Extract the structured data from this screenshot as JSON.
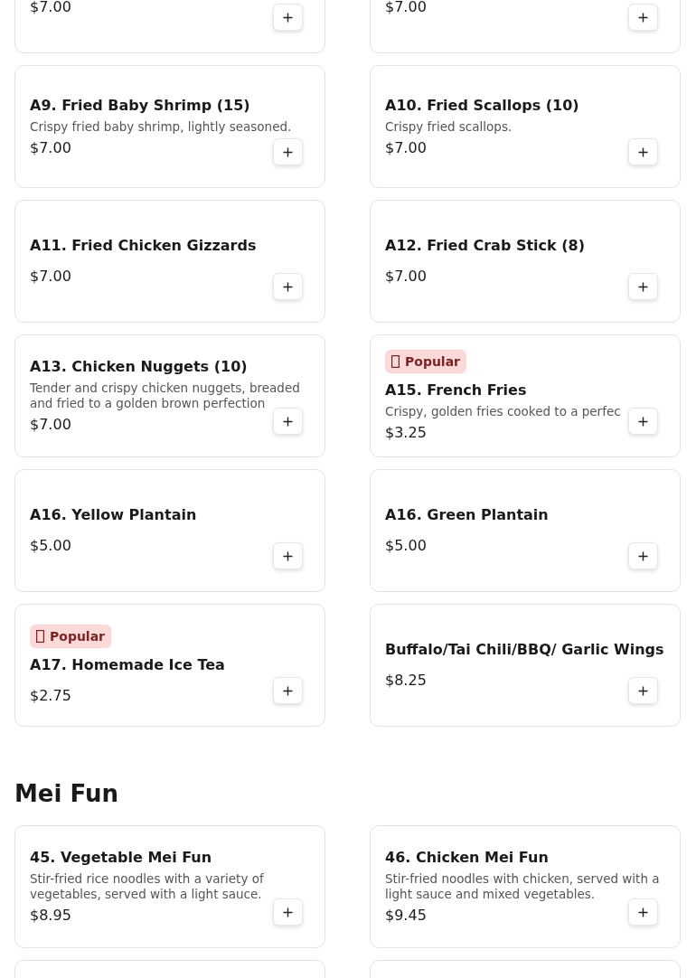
{
  "sections": [
    {
      "items": [
        {
          "kind": "cut_top",
          "price": "$7.00"
        },
        {
          "kind": "cut_top",
          "price": "$7.00"
        },
        {
          "kind": "full",
          "title": "A9. Fried Baby Shrimp (15)",
          "description": "Crispy fried baby shrimp, lightly seasoned.",
          "price": "$7.00"
        },
        {
          "kind": "full",
          "title": "A10. Fried Scallops (10)",
          "description": "Crispy fried scallops.",
          "price": "$7.00"
        },
        {
          "kind": "full",
          "title": "A11. Fried Chicken Gizzards",
          "price": "$7.00"
        },
        {
          "kind": "full",
          "title": "A12. Fried Crab Stick (8)",
          "price": "$7.00"
        },
        {
          "kind": "full",
          "title": "A13. Chicken Nuggets (10)",
          "description": "Tender and crispy chicken nuggets, breaded and fried to a golden brown perfection",
          "price": "$7.00"
        },
        {
          "kind": "full",
          "badge": "Popular",
          "title": "A15. French Fries",
          "description": "Crispy, golden fries cooked to a perfec",
          "price": "$3.25"
        },
        {
          "kind": "full",
          "title": "A16. Yellow Plantain",
          "price": "$5.00"
        },
        {
          "kind": "full",
          "title": "A16. Green Plantain",
          "price": "$5.00"
        },
        {
          "kind": "full",
          "badge": "Popular",
          "title": "A17. Homemade Ice Tea",
          "price": "$2.75"
        },
        {
          "kind": "full",
          "title": "Buffalo/Tai Chili/BBQ/ Garlic Wings",
          "price": "$8.25"
        }
      ]
    },
    {
      "heading": "Mei Fun",
      "items": [
        {
          "kind": "full",
          "title": "45. Vegetable Mei Fun",
          "description": "Stir-fried rice noodles with a variety of vegetables, served with a light sauce.",
          "price": "$8.95"
        },
        {
          "kind": "full",
          "title": "46. Chicken Mei Fun",
          "description": "Stir-fried noodles with chicken, served with a light sauce and mixed vegetables.",
          "price": "$9.45"
        },
        {
          "kind": "cut_bottom"
        },
        {
          "kind": "cut_bottom"
        }
      ]
    }
  ]
}
